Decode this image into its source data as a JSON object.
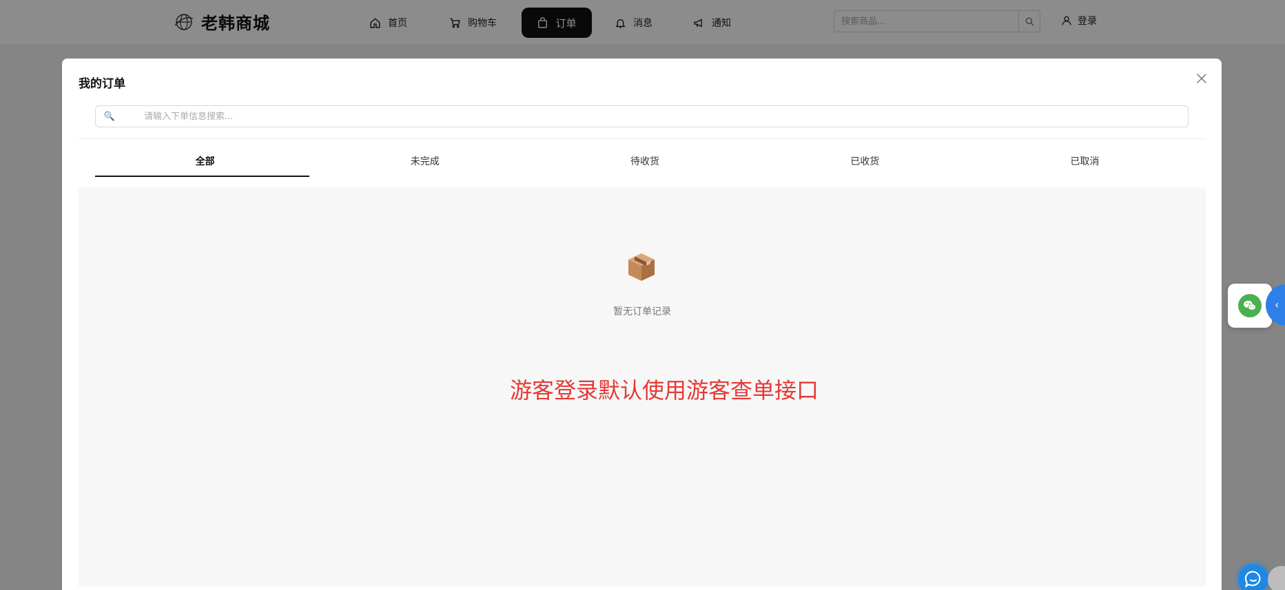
{
  "navbar": {
    "logo_text": "老韩商城",
    "items": [
      {
        "label": "首页",
        "icon": "home-icon"
      },
      {
        "label": "购物车",
        "icon": "cart-icon"
      },
      {
        "label": "订单",
        "icon": "bag-icon",
        "active": true
      },
      {
        "label": "消息",
        "icon": "bell-icon"
      },
      {
        "label": "通知",
        "icon": "megaphone-icon"
      }
    ],
    "search_placeholder": "搜索商品...",
    "login_label": "登录"
  },
  "modal": {
    "title": "我的订单",
    "search_placeholder": "请输入下单信息搜索...",
    "tabs": [
      {
        "label": "全部",
        "active": true
      },
      {
        "label": "未完成"
      },
      {
        "label": "待收货"
      },
      {
        "label": "已收货"
      },
      {
        "label": "已取消"
      }
    ],
    "empty_text": "暂无订单记录",
    "guest_note": "游客登录默认使用游客查单接口"
  },
  "colors": {
    "accent_dark": "#111111",
    "note_red": "#e53935",
    "wechat_green": "#4caf50",
    "side_blue": "#2f7fe8"
  }
}
